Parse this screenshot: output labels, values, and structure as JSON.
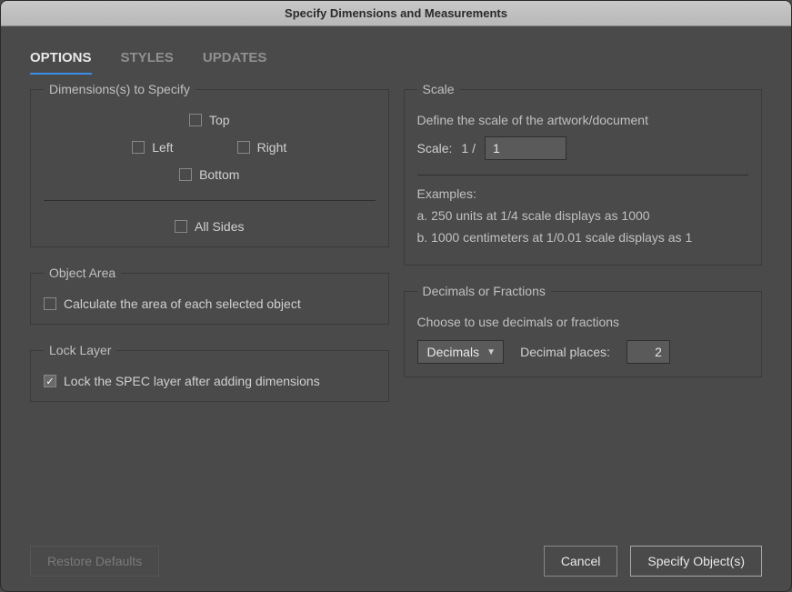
{
  "window": {
    "title": "Specify Dimensions and Measurements"
  },
  "tabs": {
    "options": "OPTIONS",
    "styles": "STYLES",
    "updates": "UPDATES"
  },
  "dimensions": {
    "legend": "Dimensions(s) to Specify",
    "top": "Top",
    "left": "Left",
    "right": "Right",
    "bottom": "Bottom",
    "all_sides": "All Sides"
  },
  "object_area": {
    "legend": "Object Area",
    "calc_label": "Calculate the area of each selected object"
  },
  "lock_layer": {
    "legend": "Lock Layer",
    "lock_label": "Lock the SPEC layer after adding dimensions"
  },
  "scale": {
    "legend": "Scale",
    "desc": "Define the scale of the artwork/document",
    "label": "Scale:",
    "one_over": "1 /",
    "value": "1",
    "examples_header": "Examples:",
    "example_a": "a. 250 units at 1/4 scale displays as 1000",
    "example_b": "b. 1000 centimeters at 1/0.01 scale displays as 1"
  },
  "decimals": {
    "legend": "Decimals or Fractions",
    "desc": "Choose to use decimals or fractions",
    "select_value": "Decimals",
    "places_label": "Decimal places:",
    "places_value": "2"
  },
  "footer": {
    "restore": "Restore Defaults",
    "cancel": "Cancel",
    "specify": "Specify Object(s)"
  }
}
